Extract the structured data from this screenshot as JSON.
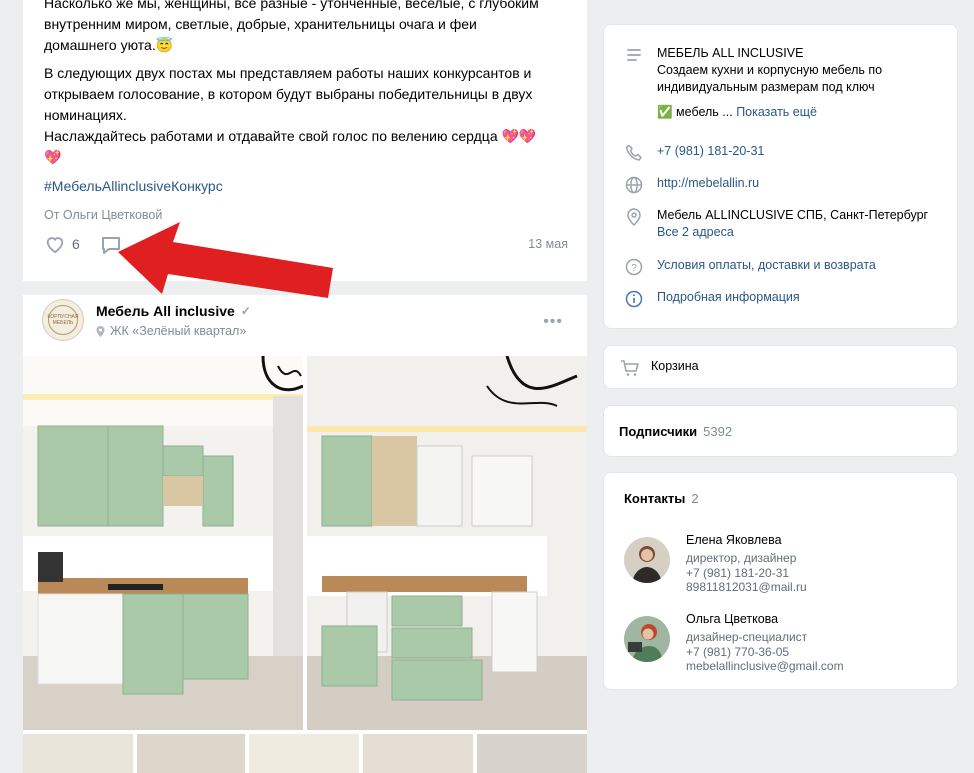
{
  "post": {
    "text_lines": [
      "Насколько же мы, женщины, все разные - утончённые, веселые, с глубоким",
      "внутренним миром, светлые, добрые, хранительницы очага и феи",
      "домашнего уюта.😇",
      "В следующих двух постах мы представляем работы наших конкурсантов и",
      "открываем голосование, в котором будут выбраны победительницы в двух",
      "номинациях.",
      "Наслаждайтесь работами и отдавайте свой голос по велению сердца 💖💖",
      "💖"
    ],
    "hashtag": "#МебельAllinclusiveКонкурс",
    "author": "От Ольги Цветковой",
    "likes": "6",
    "date": "13 мая"
  },
  "post2": {
    "group_name": "Мебель All inclusive",
    "verified_mark": "✓",
    "location": "ЖК «Зелёный квартал»",
    "avatar_text": "КОРПУСНАЯ МЕБЕЛЬ"
  },
  "info": {
    "name": "МЕБЕЛЬ ALL INCLUSIVE",
    "desc1": "Создаем кухни и корпусную мебель по",
    "desc2": "индивидуальным размерам под ключ",
    "check_text": "✅ мебель ...",
    "show_more": "Показать ещё",
    "phone": "+7 (981) 181-20-31",
    "site": "http://mebelallin.ru",
    "address": "Мебель ALLINCLUSIVE СПБ, Санкт-Петербург",
    "all_addresses": "Все 2 адреса",
    "terms": "Условия оплаты, доставки и возврата",
    "details": "Подробная информация"
  },
  "cart": {
    "label": "Корзина"
  },
  "subscribers": {
    "label": "Подписчики",
    "count": "5392"
  },
  "contacts": {
    "label": "Контакты",
    "count": "2",
    "items": [
      {
        "name": "Елена Яковлева",
        "role": "директор, дизайнер",
        "phone": "+7 (981) 181-20-31",
        "email": "89811812031@mail.ru"
      },
      {
        "name": "Ольга Цветкова",
        "role": "дизайнер-специалист",
        "phone": "+7 (981) 770-36-05",
        "email": "mebelallinclusive@gmail.com"
      }
    ]
  },
  "colors": {
    "link": "#2a5885",
    "muted": "#818c99",
    "arrow": "#e02020",
    "cabinet": "#a9c9a8"
  }
}
